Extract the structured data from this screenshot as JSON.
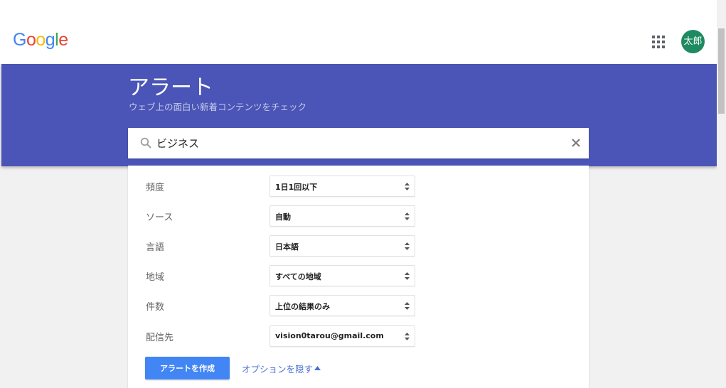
{
  "brand": {
    "logo_letters": [
      {
        "ch": "G",
        "color": "#4285f4"
      },
      {
        "ch": "o",
        "color": "#ea4335"
      },
      {
        "ch": "o",
        "color": "#fbbc05"
      },
      {
        "ch": "g",
        "color": "#4285f4"
      },
      {
        "ch": "l",
        "color": "#34a853"
      },
      {
        "ch": "e",
        "color": "#ea4335"
      }
    ]
  },
  "header": {
    "apps_icon": "apps-grid-icon",
    "avatar_text": "太郎",
    "avatar_color": "#1e8a5f"
  },
  "hero": {
    "title": "アラート",
    "subtitle": "ウェブ上の面白い新着コンテンツをチェック",
    "background": "#4a55b7"
  },
  "search": {
    "value": "ビジネス",
    "search_icon": "search-icon",
    "clear_icon": "close-icon"
  },
  "options": {
    "rows": [
      {
        "label": "頻度",
        "value": "1日1回以下"
      },
      {
        "label": "ソース",
        "value": "自動"
      },
      {
        "label": "言語",
        "value": "日本語"
      },
      {
        "label": "地域",
        "value": "すべての地域"
      },
      {
        "label": "件数",
        "value": "上位の結果のみ"
      },
      {
        "label": "配信先",
        "value": "vision0tarou@gmail.com"
      }
    ]
  },
  "actions": {
    "create_label": "アラートを作成",
    "create_color": "#4285f4",
    "toggle_options_label": "オプションを隠す"
  }
}
